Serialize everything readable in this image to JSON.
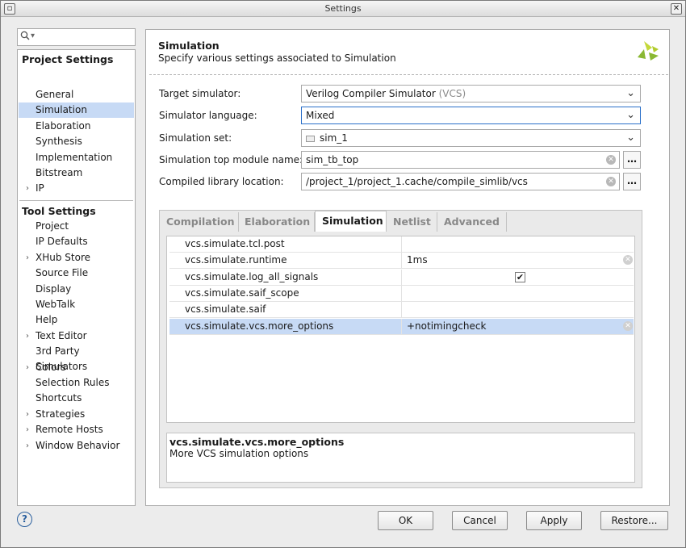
{
  "window": {
    "title": "Settings"
  },
  "search": {
    "placeholder": ""
  },
  "nav": {
    "project_header": "Project Settings",
    "project_items": [
      {
        "label": "General"
      },
      {
        "label": "Simulation",
        "selected": true
      },
      {
        "label": "Elaboration"
      },
      {
        "label": "Synthesis"
      },
      {
        "label": "Implementation"
      },
      {
        "label": "Bitstream"
      },
      {
        "label": "IP",
        "expandable": true
      }
    ],
    "tool_header": "Tool Settings",
    "tool_items": [
      {
        "label": "Project"
      },
      {
        "label": "IP Defaults"
      },
      {
        "label": "XHub Store",
        "expandable": true
      },
      {
        "label": "Source File"
      },
      {
        "label": "Display"
      },
      {
        "label": "WebTalk"
      },
      {
        "label": "Help"
      },
      {
        "label": "Text Editor",
        "expandable": true
      },
      {
        "label": "3rd Party Simulators"
      },
      {
        "label": "Colors",
        "expandable": true
      },
      {
        "label": "Selection Rules"
      },
      {
        "label": "Shortcuts"
      },
      {
        "label": "Strategies",
        "expandable": true
      },
      {
        "label": "Remote Hosts",
        "expandable": true
      },
      {
        "label": "Window Behavior",
        "expandable": true
      }
    ]
  },
  "header": {
    "title": "Simulation",
    "subtitle": "Specify various settings associated to Simulation"
  },
  "form": {
    "target_simulator": {
      "label": "Target simulator:",
      "value": "Verilog Compiler Simulator",
      "suffix": "(VCS)"
    },
    "simulator_language": {
      "label": "Simulator language:",
      "value": "Mixed"
    },
    "simulation_set": {
      "label": "Simulation set:",
      "value": "sim_1"
    },
    "top_module": {
      "label": "Simulation top module name:",
      "value": "sim_tb_top"
    },
    "compiled_library": {
      "label": "Compiled library location:",
      "value": "/project_1/project_1.cache/compile_simlib/vcs"
    },
    "browse_label": "…"
  },
  "tabs": [
    {
      "label": "Compilation",
      "active": false
    },
    {
      "label": "Elaboration",
      "active": false
    },
    {
      "label": "Simulation",
      "active": true
    },
    {
      "label": "Netlist",
      "active": false
    },
    {
      "label": "Advanced",
      "active": false
    }
  ],
  "options_table": {
    "rows": [
      {
        "key": "vcs.simulate.tcl.post",
        "value": ""
      },
      {
        "key": "vcs.simulate.runtime",
        "value": "1ms"
      },
      {
        "key": "vcs.simulate.log_all_signals",
        "value": "",
        "checkbox": true,
        "checked": true
      },
      {
        "key": "vcs.simulate.saif_scope",
        "value": ""
      },
      {
        "key": "vcs.simulate.saif",
        "value": ""
      },
      {
        "key": "vcs.simulate.vcs.more_options",
        "value": "+notimingcheck",
        "selected": true
      }
    ]
  },
  "description": {
    "key": "vcs.simulate.vcs.more_options",
    "text": "More VCS simulation options"
  },
  "buttons": {
    "help": "?",
    "ok": "OK",
    "cancel": "Cancel",
    "apply": "Apply",
    "restore": "Restore..."
  },
  "colors": {
    "selection": "#c7daf5",
    "focus_border": "#2a6fc9",
    "logo_green": "#8ab833"
  }
}
